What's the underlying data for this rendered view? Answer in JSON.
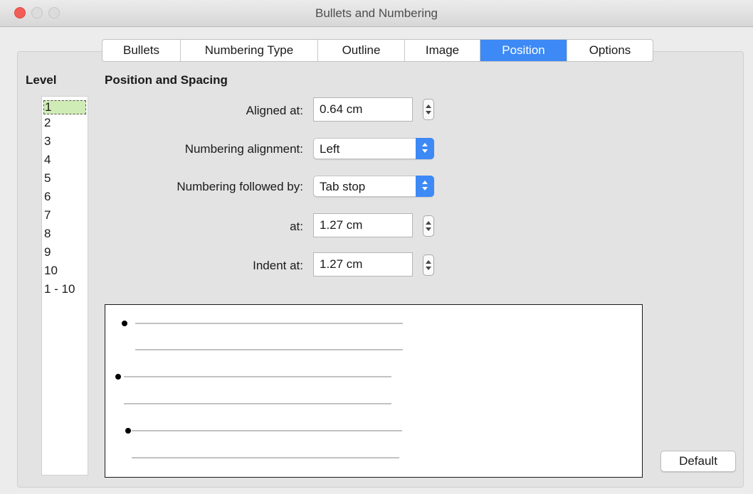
{
  "window": {
    "title": "Bullets and Numbering"
  },
  "tabs": [
    {
      "label": "Bullets"
    },
    {
      "label": "Numbering Type"
    },
    {
      "label": "Outline"
    },
    {
      "label": "Image"
    },
    {
      "label": "Position",
      "active": true
    },
    {
      "label": "Options"
    }
  ],
  "level": {
    "heading": "Level",
    "items": [
      "1",
      "2",
      "3",
      "4",
      "5",
      "6",
      "7",
      "8",
      "9",
      "10",
      "1 - 10"
    ],
    "selected": "1"
  },
  "position": {
    "section_title": "Position and Spacing",
    "aligned_at": {
      "label": "Aligned at:",
      "value": "0.64 cm"
    },
    "numbering_alignment": {
      "label": "Numbering alignment:",
      "value": "Left"
    },
    "numbering_followed_by": {
      "label": "Numbering followed by:",
      "value": "Tab stop"
    },
    "tab_at": {
      "label": "at:",
      "value": "1.27 cm"
    },
    "indent_at": {
      "label": "Indent at:",
      "value": "1.27 cm"
    }
  },
  "buttons": {
    "default": "Default"
  },
  "colors": {
    "accent": "#3d89f5",
    "selected_level": "#cfecb6",
    "close": "#f25e57"
  },
  "icons": {
    "spinner": "stepper-icon",
    "select_caret": "chevron-updown-icon"
  }
}
